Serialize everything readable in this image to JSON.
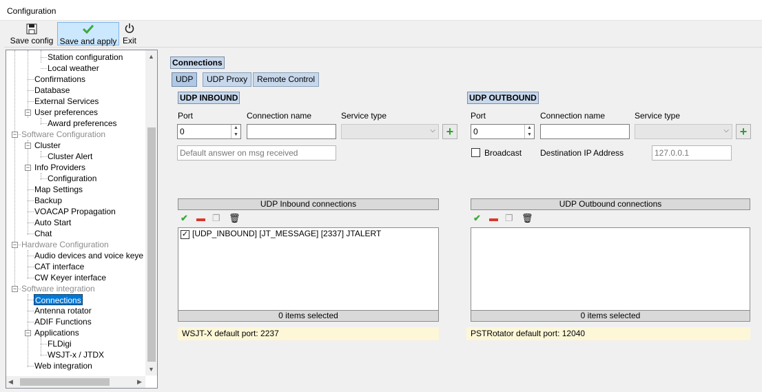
{
  "window": {
    "title": "Configuration"
  },
  "toolbar": {
    "save_config": "Save config",
    "save_apply": "Save and apply",
    "exit": "Exit"
  },
  "tree": {
    "items": [
      "Station configuration",
      "Local weather",
      "Confirmations",
      "Database",
      "External Services",
      "User preferences",
      "Award preferences",
      "Software Configuration",
      "Cluster",
      "Cluster Alert",
      "Info Providers",
      "Configuration",
      "Map Settings",
      "Backup",
      "VOACAP Propagation",
      "Auto Start",
      "Chat",
      "Hardware Configuration",
      "Audio devices and voice keye",
      "CAT interface",
      "CW Keyer interface",
      "Software integration",
      "Connections",
      "Antenna rotator",
      "ADIF Functions",
      "Applications",
      "FLDigi",
      "WSJT-x / JTDX",
      "Web integration"
    ]
  },
  "main": {
    "section_title": "Connections",
    "tabs": [
      "UDP",
      "UDP Proxy",
      "Remote Control"
    ],
    "inbound": {
      "title": "UDP INBOUND",
      "port_label": "Port",
      "port_value": "0",
      "name_label": "Connection name",
      "name_value": "",
      "service_label": "Service type",
      "default_answer_placeholder": "Default answer on msg received",
      "list_title": "UDP Inbound connections",
      "list_items": [
        "[UDP_INBOUND] [JT_MESSAGE] [2337] JTALERT"
      ],
      "footer": "0 items selected",
      "hint": "WSJT-X default port: 2237"
    },
    "outbound": {
      "title": "UDP OUTBOUND",
      "port_label": "Port",
      "port_value": "0",
      "name_label": "Connection name",
      "name_value": "",
      "service_label": "Service type",
      "broadcast_label": "Broadcast",
      "dest_label": "Destination IP Address",
      "dest_value": "127.0.0.1",
      "list_title": "UDP Outbound connections",
      "footer": "0 items selected",
      "hint": "PSTRotator default port: 12040"
    }
  },
  "colors": {
    "selection": "#0078d7",
    "accent_green": "#2ea02e",
    "remove_red": "#d9342b"
  },
  "icons": [
    "floppy-icon",
    "checkmark-icon",
    "power-icon",
    "plus-icon",
    "trash-icon",
    "copy-icon",
    "minus-icon"
  ]
}
